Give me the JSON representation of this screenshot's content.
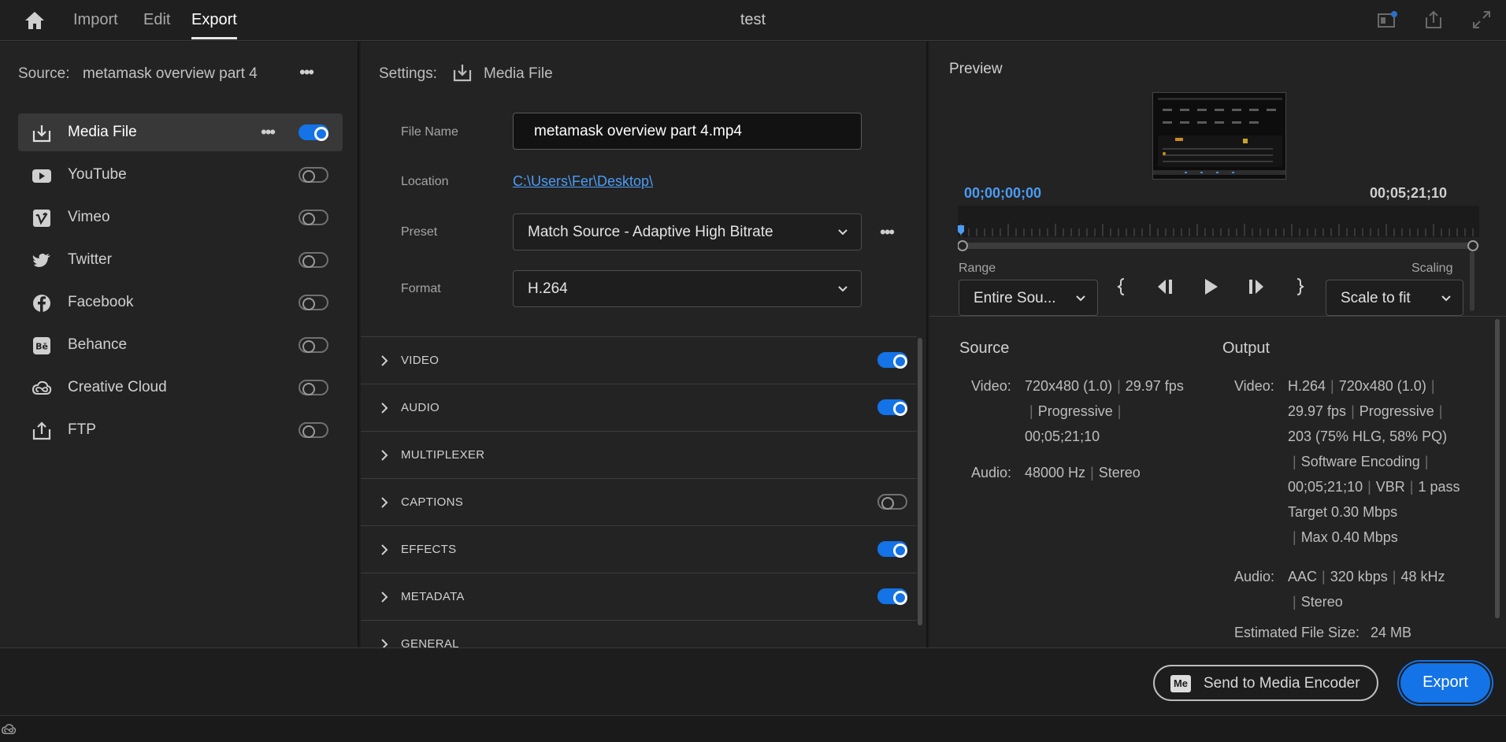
{
  "topbar": {
    "tabs": [
      "Import",
      "Edit",
      "Export"
    ],
    "active_tab": "Export",
    "title": "test"
  },
  "left": {
    "source_label": "Source:",
    "source_name": "metamask overview part 4",
    "destinations": [
      {
        "label": "Media File",
        "enabled": true,
        "icon": "download-icon"
      },
      {
        "label": "YouTube",
        "enabled": false,
        "icon": "youtube-icon"
      },
      {
        "label": "Vimeo",
        "enabled": false,
        "icon": "vimeo-icon"
      },
      {
        "label": "Twitter",
        "enabled": false,
        "icon": "twitter-icon"
      },
      {
        "label": "Facebook",
        "enabled": false,
        "icon": "facebook-icon"
      },
      {
        "label": "Behance",
        "enabled": false,
        "icon": "behance-icon"
      },
      {
        "label": "Creative Cloud",
        "enabled": false,
        "icon": "creative-cloud-icon"
      },
      {
        "label": "FTP",
        "enabled": false,
        "icon": "upload-icon"
      }
    ]
  },
  "settings": {
    "label": "Settings:",
    "target": "Media File",
    "file_name_label": "File Name",
    "file_name": "metamask overview part 4.mp4",
    "location_label": "Location",
    "location": "C:\\Users\\Fer\\Desktop\\",
    "preset_label": "Preset",
    "preset": "Match Source - Adaptive High Bitrate",
    "format_label": "Format",
    "format": "H.264",
    "sections": [
      {
        "label": "VIDEO",
        "toggle": "on"
      },
      {
        "label": "AUDIO",
        "toggle": "on"
      },
      {
        "label": "MULTIPLEXER",
        "toggle": "none"
      },
      {
        "label": "CAPTIONS",
        "toggle": "off"
      },
      {
        "label": "EFFECTS",
        "toggle": "on"
      },
      {
        "label": "METADATA",
        "toggle": "on"
      },
      {
        "label": "GENERAL",
        "toggle": "none"
      }
    ]
  },
  "preview": {
    "title": "Preview",
    "timecode_start": "00;00;00;00",
    "timecode_end": "00;05;21;10",
    "range_label": "Range",
    "range_value": "Entire Sou...",
    "scaling_label": "Scaling",
    "scaling_value": "Scale to fit"
  },
  "info": {
    "source_title": "Source",
    "output_title": "Output",
    "video_key": "Video:",
    "audio_key": "Audio:",
    "source_video": [
      "720x480 (1.0)",
      "29.97 fps",
      "Progressive",
      "00;05;21;10"
    ],
    "source_audio": [
      "48000 Hz",
      "Stereo"
    ],
    "output_video": [
      "H.264",
      "720x480 (1.0)",
      "29.97 fps",
      "Progressive",
      "203 (75% HLG, 58% PQ)",
      "Software Encoding",
      "00;05;21;10",
      "VBR",
      "1 pass",
      "Target 0.30 Mbps",
      "Max 0.40 Mbps"
    ],
    "output_audio": [
      "AAC",
      "320 kbps",
      "48 kHz",
      "Stereo"
    ],
    "file_size_label": "Estimated File Size:",
    "file_size": "24 MB"
  },
  "bottom": {
    "send_label": "Send to Media Encoder",
    "me_badge": "Me",
    "export_label": "Export"
  },
  "colors": {
    "accent": "#1473e6",
    "timecode": "#4b9cf5",
    "background": "#232323"
  }
}
